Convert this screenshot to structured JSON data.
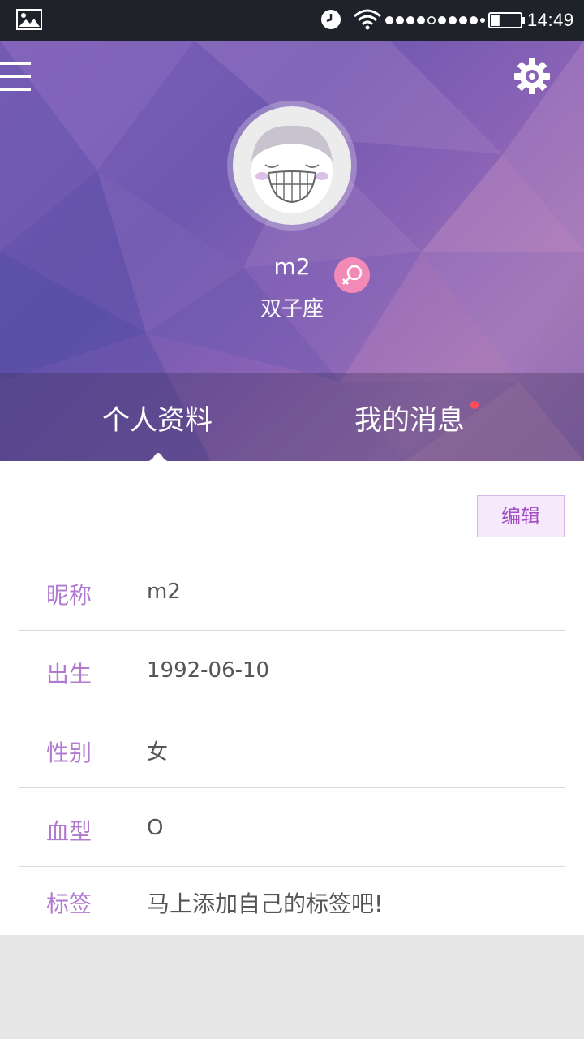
{
  "status_bar": {
    "time": "14:49",
    "icons": [
      "gallery-icon",
      "alarm-icon",
      "wifi-icon",
      "signal-dots-icon",
      "battery-icon"
    ],
    "battery_level": 0.3
  },
  "header": {
    "menu_icon": "hamburger-icon",
    "settings_icon": "gear-icon",
    "username": "m2",
    "zodiac": "双子座",
    "gender_icon": "female-symbol-icon",
    "colors": {
      "gender_badge": "#f28ab8",
      "tab_dot": "#ff4c5b"
    }
  },
  "tabs": [
    {
      "label": "个人资料",
      "active": true
    },
    {
      "label": "我的消息",
      "has_notification": true
    }
  ],
  "profile": {
    "edit_label": "编辑",
    "rows": [
      {
        "label": "昵称",
        "value": "m2"
      },
      {
        "label": "出生",
        "value": "1992-06-10"
      },
      {
        "label": "性别",
        "value": "女"
      },
      {
        "label": "血型",
        "value": "O"
      },
      {
        "label": "标签",
        "value": "马上添加自己的标签吧!"
      }
    ]
  },
  "colors": {
    "accent": "#b17ad1",
    "edit_bg": "#f6e9fb"
  }
}
